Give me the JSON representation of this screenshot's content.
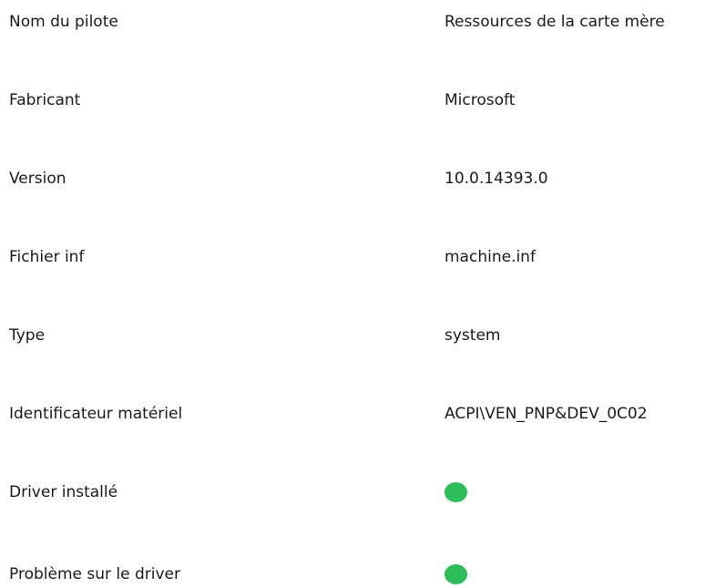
{
  "properties": [
    {
      "label": "Nom du pilote",
      "value": "Ressources de la carte mère"
    },
    {
      "label": "Fabricant",
      "value": "Microsoft"
    },
    {
      "label": "Version",
      "value": "10.0.14393.0"
    },
    {
      "label": "Fichier inf",
      "value": "machine.inf"
    },
    {
      "label": "Type",
      "value": "system"
    },
    {
      "label": "Identificateur matériel",
      "value": "ACPI\\VEN_PNP&DEV_0C02"
    },
    {
      "label": "Driver installé",
      "status_color": "#2ebd59"
    },
    {
      "label": "Problème sur le driver",
      "status_color": "#2ebd59"
    }
  ]
}
